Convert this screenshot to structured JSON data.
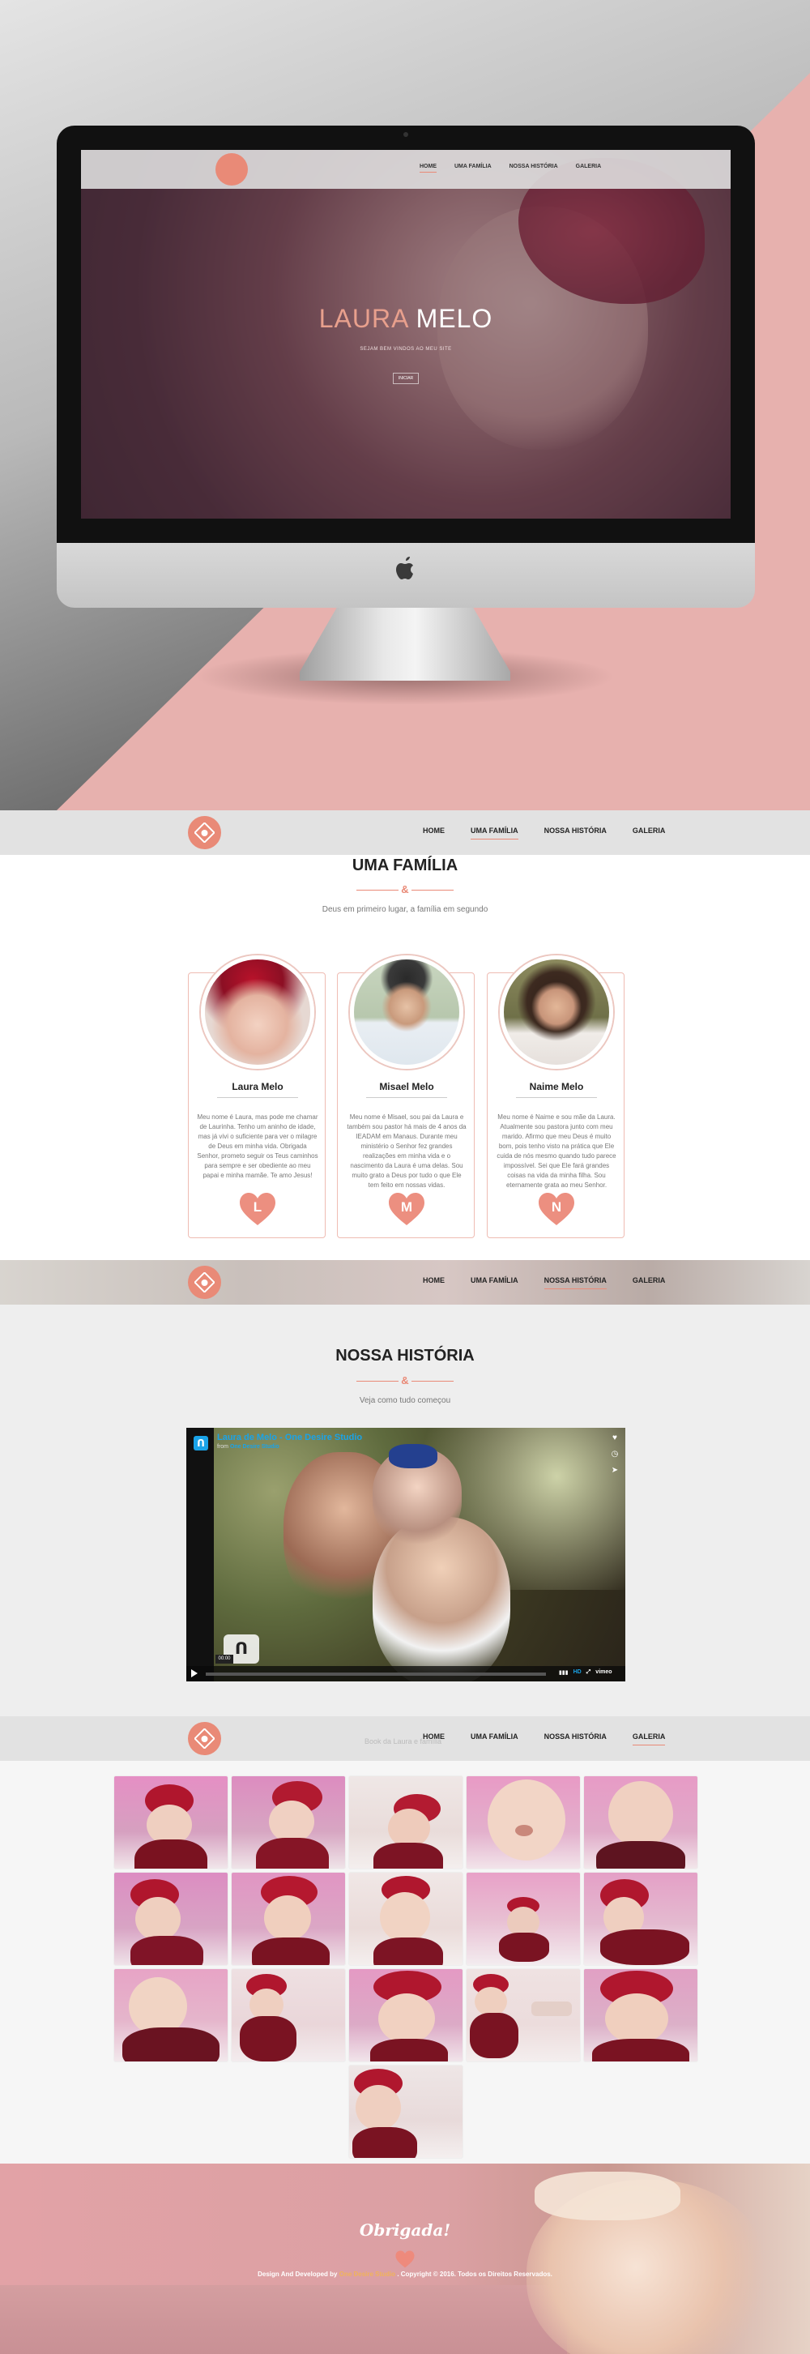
{
  "hero_screen": {
    "menu": [
      "HOME",
      "UMA FAMÍLIA",
      "NOSSA HISTÓRIA",
      "GALERIA"
    ],
    "active_menu": "HOME",
    "title_first": "LAURA",
    "title_last": "MELO",
    "subtitle": "SEJAM BEM VINDOS AO MEU SITE",
    "button": "INICIAR"
  },
  "nav": {
    "home": "HOME",
    "family": "UMA FAMÍLIA",
    "story": "NOSSA HISTÓRIA",
    "gallery": "GALERIA"
  },
  "family": {
    "title": "UMA FAMÍLIA",
    "divider_symbol": "&",
    "subtitle": "Deus em primeiro lugar, a família em segundo",
    "members": [
      {
        "name": "Laura Melo",
        "bio": "Meu nome é Laura, mas pode me chamar de Laurinha. Tenho um aninho de idade, mas já vivi o suficiente para ver o milagre de Deus em minha vida. Obrigada Senhor, prometo seguir os Teus caminhos para sempre e ser obediente ao meu papai e minha mamãe. Te amo Jesus!",
        "initial": "L"
      },
      {
        "name": "Misael Melo",
        "bio": "Meu nome é Misael, sou pai da Laura e também sou pastor há mais de 4 anos da IEADAM em Manaus. Durante meu ministério o Senhor fez grandes realizações em minha vida e o nascimento da Laura é uma delas. Sou muito grato a Deus por tudo o que Ele tem feito em nossas vidas.",
        "initial": "M"
      },
      {
        "name": "Naime Melo",
        "bio": "Meu nome é Naime e sou mãe da Laura. Atualmente sou pastora junto com meu marido. Afirmo que meu Deus é muito bom, pois tenho visto na prática que Ele cuida de nós mesmo quando tudo parece impossível. Sei que Ele fará grandes coisas na vida da minha filha. Sou eternamente grata ao meu Senhor.",
        "initial": "N"
      }
    ]
  },
  "story": {
    "title": "NOSSA HISTÓRIA",
    "divider_symbol": "&",
    "subtitle": "Veja como tudo começou",
    "video": {
      "title": "Laura de Melo - One Desire Studio",
      "from_label": "from",
      "from_name": "One Desire Studio",
      "time": "00:00",
      "hd_label": "HD",
      "brand": "vimeo",
      "watermark": "ᑎ"
    }
  },
  "gallery": {
    "ghost_subtitle": "Book da Laura e família",
    "thumb_count": 16
  },
  "footer": {
    "thanks": "Obrigada!",
    "credits_prefix": "Design And Developed by",
    "studio": "One Desire Studio",
    "credits_suffix": ". Copyright © 2016. Todos os Direitos Reservados."
  },
  "colors": {
    "accent": "#e98a77",
    "hero_pink": "#e7b1ae",
    "nav_bg": "#e2e2e2",
    "vimeo_blue": "#1aa3e8"
  }
}
